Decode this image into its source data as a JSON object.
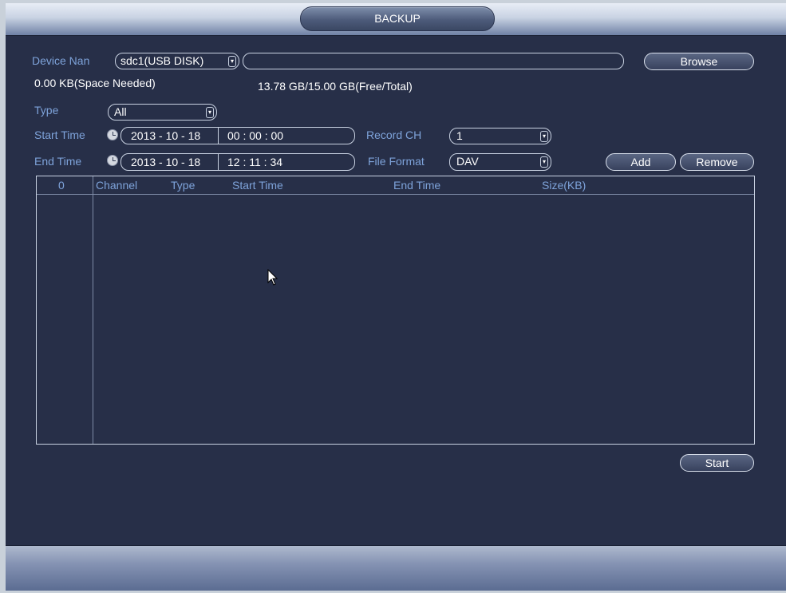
{
  "window": {
    "title": "BACKUP"
  },
  "device": {
    "label": "Device Nan",
    "selected": "sdc1(USB DISK)",
    "path_value": "",
    "browse_label": "Browse"
  },
  "space": {
    "needed": "0.00 KB(Space Needed)",
    "free_total": "13.78 GB/15.00 GB(Free/Total)"
  },
  "type": {
    "label": "Type",
    "selected": "All"
  },
  "start_time": {
    "label": "Start Time",
    "date": "2013 - 10 - 18",
    "time": "00 : 00 : 00"
  },
  "end_time": {
    "label": "End Time",
    "date": "2013 - 10 - 18",
    "time": "12 : 11 : 34"
  },
  "record_ch": {
    "label": "Record CH",
    "selected": "1"
  },
  "file_format": {
    "label": "File Format",
    "selected": "DAV"
  },
  "buttons": {
    "add": "Add",
    "remove": "Remove",
    "start": "Start"
  },
  "table": {
    "columns": [
      "0",
      "Channel",
      "Type",
      "Start Time",
      "End Time",
      "Size(KB)"
    ],
    "rows": []
  },
  "icons": {
    "clock": "clock-icon",
    "dropdown": "dropdown-arrow-icon",
    "cursor": "mouse-pointer-icon"
  },
  "colors": {
    "background": "#272f48",
    "label": "#7ea3da",
    "text": "#ffffff"
  }
}
